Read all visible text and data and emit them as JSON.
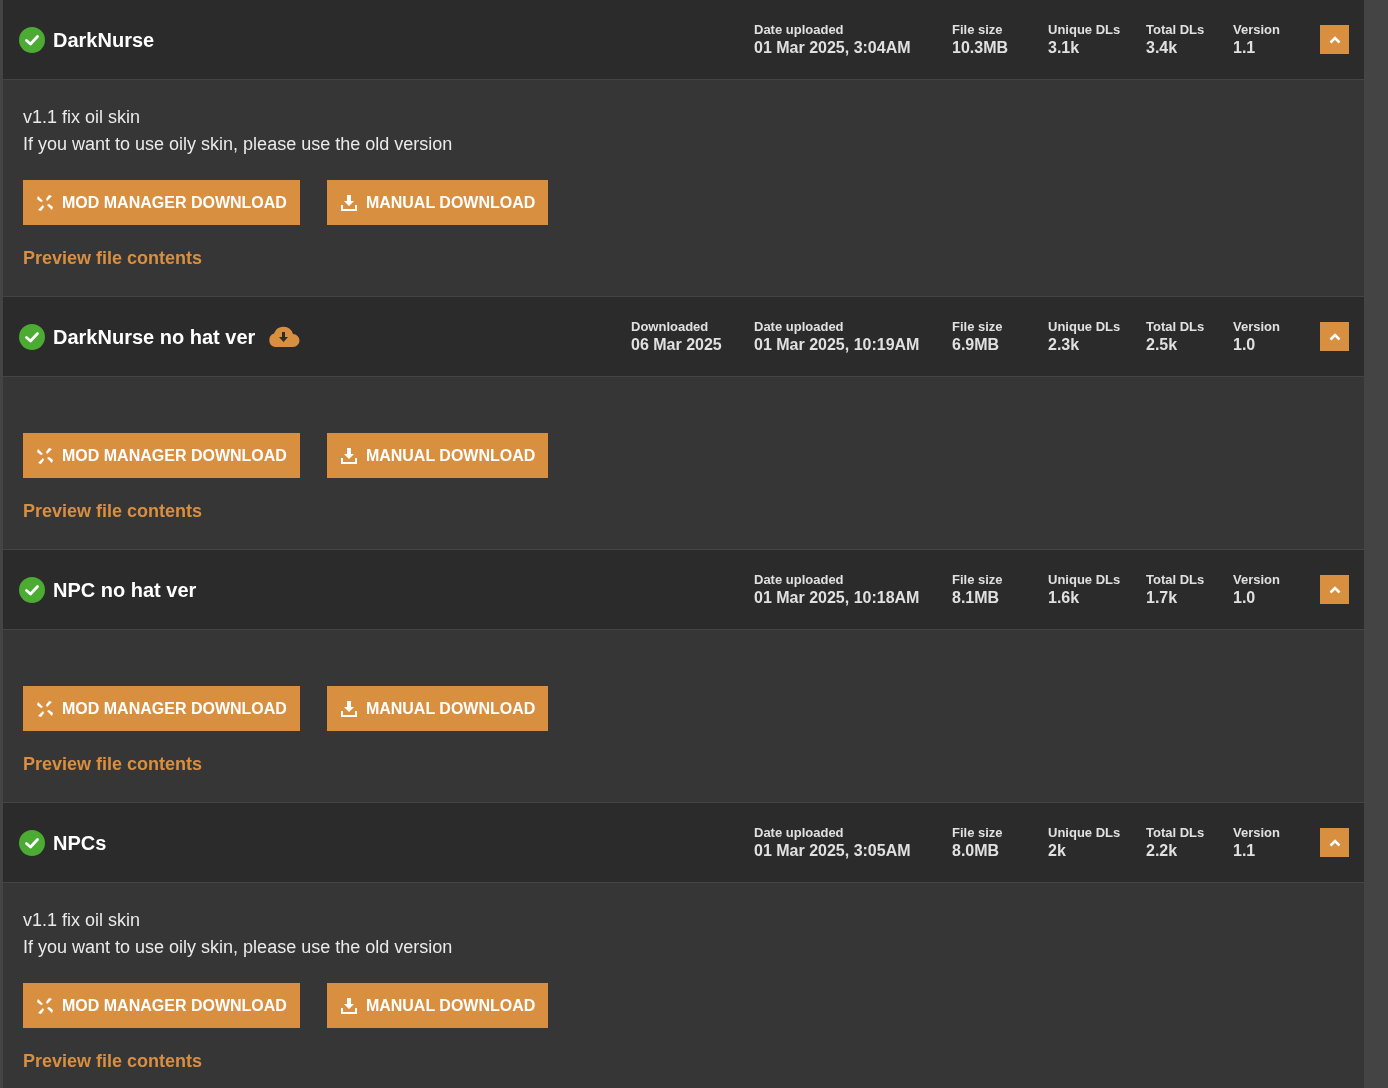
{
  "files": [
    {
      "title": "DarkNurse",
      "verified": true,
      "downloaded_icon": false,
      "expanded": true,
      "stats": [
        {
          "kind": "date",
          "label": "Date uploaded",
          "value": "01 Mar 2025, 3:04AM"
        },
        {
          "kind": "size",
          "label": "File size",
          "value": "10.3MB"
        },
        {
          "kind": "unique",
          "label": "Unique DLs",
          "value": "3.1k"
        },
        {
          "kind": "total",
          "label": "Total DLs",
          "value": "3.4k"
        },
        {
          "kind": "version",
          "label": "Version",
          "value": "1.1"
        }
      ],
      "description": [
        "v1.1 fix oil skin",
        "If you want to use oily skin, please use the old version"
      ],
      "buttons": [
        {
          "kind": "manager",
          "label": "MOD MANAGER DOWNLOAD"
        },
        {
          "kind": "manual",
          "label": "MANUAL DOWNLOAD"
        }
      ],
      "preview": "Preview file contents"
    },
    {
      "title": "DarkNurse no hat ver",
      "verified": true,
      "downloaded_icon": true,
      "expanded": true,
      "stats": [
        {
          "kind": "downloaded",
          "label": "Downloaded",
          "value": "06 Mar 2025"
        },
        {
          "kind": "date",
          "label": "Date uploaded",
          "value": "01 Mar 2025, 10:19AM"
        },
        {
          "kind": "size",
          "label": "File size",
          "value": "6.9MB"
        },
        {
          "kind": "unique",
          "label": "Unique DLs",
          "value": "2.3k"
        },
        {
          "kind": "total",
          "label": "Total DLs",
          "value": "2.5k"
        },
        {
          "kind": "version",
          "label": "Version",
          "value": "1.0"
        }
      ],
      "buttons": [
        {
          "kind": "manager",
          "label": "MOD MANAGER DOWNLOAD"
        },
        {
          "kind": "manual",
          "label": "MANUAL DOWNLOAD"
        }
      ],
      "preview": "Preview file contents"
    },
    {
      "title": "NPC no hat ver",
      "verified": true,
      "downloaded_icon": false,
      "expanded": true,
      "stats": [
        {
          "kind": "date",
          "label": "Date uploaded",
          "value": "01 Mar 2025, 10:18AM"
        },
        {
          "kind": "size",
          "label": "File size",
          "value": "8.1MB"
        },
        {
          "kind": "unique",
          "label": "Unique DLs",
          "value": "1.6k"
        },
        {
          "kind": "total",
          "label": "Total DLs",
          "value": "1.7k"
        },
        {
          "kind": "version",
          "label": "Version",
          "value": "1.0"
        }
      ],
      "buttons": [
        {
          "kind": "manager",
          "label": "MOD MANAGER DOWNLOAD"
        },
        {
          "kind": "manual",
          "label": "MANUAL DOWNLOAD"
        }
      ],
      "preview": "Preview file contents"
    },
    {
      "title": "NPCs",
      "verified": true,
      "downloaded_icon": false,
      "expanded": true,
      "stats": [
        {
          "kind": "date",
          "label": "Date uploaded",
          "value": "01 Mar 2025, 3:05AM"
        },
        {
          "kind": "size",
          "label": "File size",
          "value": "8.0MB"
        },
        {
          "kind": "unique",
          "label": "Unique DLs",
          "value": "2k"
        },
        {
          "kind": "total",
          "label": "Total DLs",
          "value": "2.2k"
        },
        {
          "kind": "version",
          "label": "Version",
          "value": "1.1"
        }
      ],
      "description": [
        "v1.1 fix oil skin",
        "If you want to use oily skin, please use the old version"
      ],
      "buttons": [
        {
          "kind": "manager",
          "label": "MOD MANAGER DOWNLOAD"
        },
        {
          "kind": "manual",
          "label": "MANUAL DOWNLOAD"
        }
      ],
      "preview": "Preview file contents"
    }
  ]
}
